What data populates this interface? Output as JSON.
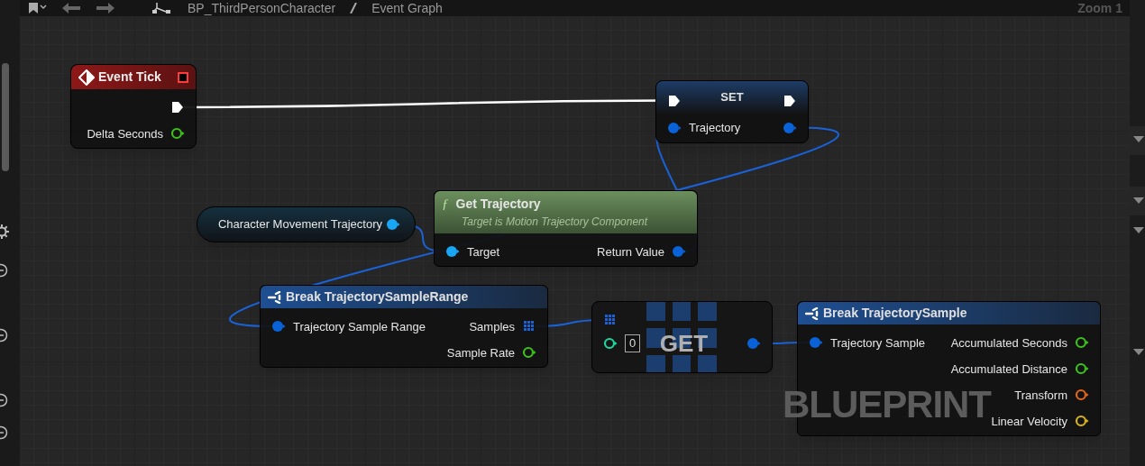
{
  "toolbar": {
    "breadcrumb": [
      "BP_ThirdPersonCharacter",
      "Event Graph"
    ],
    "zoom": "Zoom 1"
  },
  "graph": {
    "watermark": "BLUEPRINT",
    "nodes": [
      {
        "kind": "event",
        "title": "Event Tick",
        "rows": [
          {
            "right": {
              "kind": "exec"
            }
          },
          {
            "right": {
              "label": "Delta Seconds",
              "kind": "float"
            }
          }
        ]
      },
      {
        "kind": "set",
        "title": "SET",
        "rows": [
          {
            "left": {
              "kind": "exec"
            },
            "right": {
              "kind": "exec"
            }
          },
          {
            "left": {
              "label": "Trajectory",
              "kind": "struct"
            },
            "right": {
              "kind": "struct"
            }
          }
        ]
      },
      {
        "kind": "variable",
        "title": "Character Movement Trajectory",
        "rows": [
          {
            "right": {
              "kind": "object"
            }
          }
        ]
      },
      {
        "kind": "function",
        "icon": "ƒ",
        "title": "Get Trajectory",
        "subtitle": "Target is Motion Trajectory Component",
        "rows": [
          {
            "left": {
              "label": "Target",
              "kind": "object"
            },
            "right": {
              "label": "Return Value",
              "kind": "struct"
            }
          }
        ]
      },
      {
        "kind": "break",
        "title": "Break TrajectorySampleRange",
        "rows": [
          {
            "left": {
              "label": "Trajectory Sample Range",
              "kind": "struct"
            },
            "right": {
              "label": "Samples",
              "kind": "array"
            }
          },
          {
            "right": {
              "label": "Sample Rate",
              "kind": "float"
            }
          }
        ]
      },
      {
        "kind": "get",
        "title": "GET",
        "rows": [
          {
            "left": {
              "kind": "array"
            }
          },
          {
            "left": {
              "kind": "int",
              "value": "0"
            },
            "right": {
              "kind": "struct"
            }
          }
        ]
      },
      {
        "kind": "break",
        "title": "Break TrajectorySample",
        "rows": [
          {
            "left": {
              "label": "Trajectory Sample",
              "kind": "struct"
            },
            "right": {
              "label": "Accumulated Seconds",
              "kind": "float"
            }
          },
          {
            "right": {
              "label": "Accumulated Distance",
              "kind": "float"
            }
          },
          {
            "right": {
              "label": "Transform",
              "kind": "transform"
            }
          },
          {
            "right": {
              "label": "Linear Velocity",
              "kind": "vector"
            }
          }
        ]
      }
    ]
  }
}
